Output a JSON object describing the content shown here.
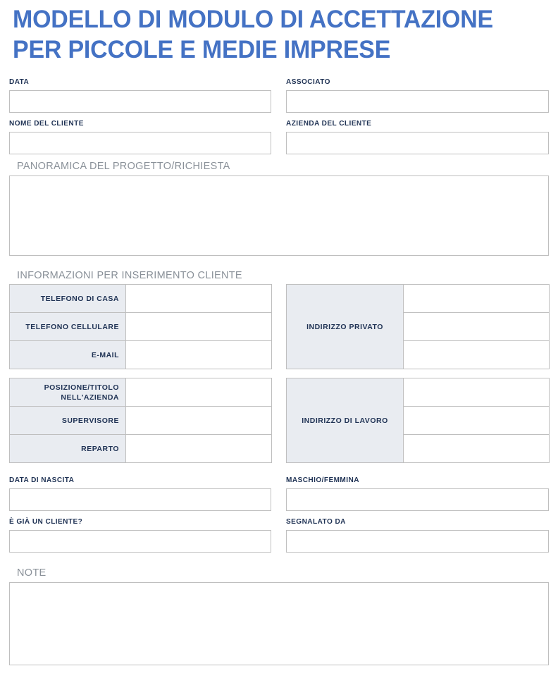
{
  "document": {
    "title_lines": [
      "MODELLO DI MODULO DI ACCETTAZIONE",
      "PER PICCOLE E MEDIE IMPRESE"
    ],
    "title_color": "#4472C4",
    "label_color": "#1F3254",
    "heading_color": "#8A9199",
    "border_color": "#BFBFBF",
    "cell_fill_color": "#E9ECF1",
    "background_color": "#FFFFFF"
  },
  "fields": {
    "data": {
      "label": "DATA",
      "value": "",
      "placeholder": ""
    },
    "associato": {
      "label": "ASSOCIATO",
      "value": "",
      "placeholder": ""
    },
    "nome_cliente": {
      "label": "NOME DEL CLIENTE",
      "value": "",
      "placeholder": ""
    },
    "azienda_cliente": {
      "label": "AZIENDA DEL CLIENTE",
      "value": "",
      "placeholder": ""
    },
    "data_nascita": {
      "label": "DATA DI NASCITA",
      "value": "",
      "placeholder": ""
    },
    "maschio_femmina": {
      "label": "MASCHIO/FEMMINA",
      "value": "",
      "placeholder": ""
    },
    "gia_cliente": {
      "label": "È GIÀ UN CLIENTE?",
      "value": "",
      "placeholder": ""
    },
    "segnalato_da": {
      "label": "SEGNALATO DA",
      "value": "",
      "placeholder": ""
    }
  },
  "sections": {
    "panoramica": {
      "heading": "PANORAMICA DEL PROGETTO/RICHIESTA",
      "value": "",
      "placeholder": ""
    },
    "informazioni": {
      "heading": "INFORMAZIONI PER INSERIMENTO CLIENTE"
    },
    "note": {
      "heading": "NOTE",
      "value": "",
      "placeholder": ""
    }
  },
  "contact_table": {
    "rows": [
      {
        "label": "TELEFONO DI CASA",
        "value": ""
      },
      {
        "label": "TELEFONO CELLULARE",
        "value": ""
      },
      {
        "label": "E-MAIL",
        "value": ""
      }
    ]
  },
  "employment_table": {
    "rows": [
      {
        "label": "POSIZIONE/TITOLO NELL'AZIENDA",
        "value": ""
      },
      {
        "label": "SUPERVISORE",
        "value": ""
      },
      {
        "label": "REPARTO",
        "value": ""
      }
    ]
  },
  "home_address_table": {
    "label": "INDIRIZZO PRIVATO",
    "values": [
      "",
      "",
      ""
    ]
  },
  "work_address_table": {
    "label": "INDIRIZZO DI LAVORO",
    "values": [
      "",
      "",
      ""
    ]
  }
}
